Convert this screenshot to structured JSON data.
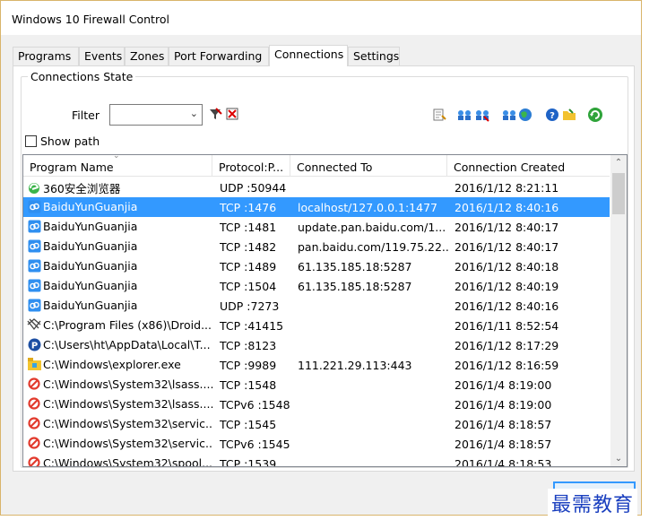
{
  "window": {
    "title": "Windows 10 Firewall Control"
  },
  "tabs": [
    {
      "label": "Programs",
      "active": false
    },
    {
      "label": "Events",
      "active": false
    },
    {
      "label": "Zones",
      "active": false
    },
    {
      "label": "Port Forwarding",
      "active": false
    },
    {
      "label": "Connections",
      "active": true
    },
    {
      "label": "Settings",
      "active": false
    }
  ],
  "group": {
    "title": "Connections State"
  },
  "filter": {
    "label": "Filter",
    "value": ""
  },
  "show_path": {
    "label": "Show path",
    "checked": false
  },
  "table": {
    "columns": [
      "Program Name",
      "Protocol:P...",
      "Connected To",
      "Connection Created"
    ],
    "rows": [
      {
        "icon": "360-browser-icon",
        "name": "360安全浏览器",
        "protocol": "UDP :50944",
        "connected": "",
        "created": "2016/1/12 8:21:11",
        "selected": false
      },
      {
        "icon": "baidu-cloud-icon",
        "name": "BaiduYunGuanjia",
        "protocol": "TCP :1476",
        "connected": "localhost/127.0.0.1:1477",
        "created": "2016/1/12 8:40:16",
        "selected": true
      },
      {
        "icon": "baidu-cloud-icon",
        "name": "BaiduYunGuanjia",
        "protocol": "TCP :1481",
        "connected": "update.pan.baidu.com/1...",
        "created": "2016/1/12 8:40:17",
        "selected": false
      },
      {
        "icon": "baidu-cloud-icon",
        "name": "BaiduYunGuanjia",
        "protocol": "TCP :1482",
        "connected": "pan.baidu.com/119.75.22...",
        "created": "2016/1/12 8:40:17",
        "selected": false
      },
      {
        "icon": "baidu-cloud-icon",
        "name": "BaiduYunGuanjia",
        "protocol": "TCP :1489",
        "connected": "61.135.185.18:5287",
        "created": "2016/1/12 8:40:18",
        "selected": false
      },
      {
        "icon": "baidu-cloud-icon",
        "name": "BaiduYunGuanjia",
        "protocol": "TCP :1504",
        "connected": "61.135.185.18:5287",
        "created": "2016/1/12 8:40:19",
        "selected": false
      },
      {
        "icon": "baidu-cloud-icon",
        "name": "BaiduYunGuanjia",
        "protocol": "UDP :7273",
        "connected": "",
        "created": "2016/1/12 8:40:16",
        "selected": false
      },
      {
        "icon": "droid-icon",
        "name": "C:\\Program Files (x86)\\Droid...",
        "protocol": "TCP :41415",
        "connected": "",
        "created": "2016/1/11 8:52:54",
        "selected": false
      },
      {
        "icon": "p-app-icon",
        "name": "C:\\Users\\ht\\AppData\\Local\\T...",
        "protocol": "TCP :8123",
        "connected": "",
        "created": "2016/1/12 8:17:29",
        "selected": false
      },
      {
        "icon": "explorer-icon",
        "name": "C:\\Windows\\explorer.exe",
        "protocol": "TCP :9989",
        "connected": "111.221.29.113:443",
        "created": "2016/1/12 8:16:59",
        "selected": false
      },
      {
        "icon": "blocked-icon",
        "name": "C:\\Windows\\System32\\lsass....",
        "protocol": "TCP :1548",
        "connected": "",
        "created": "2016/1/4 8:19:00",
        "selected": false
      },
      {
        "icon": "blocked-icon",
        "name": "C:\\Windows\\System32\\lsass....",
        "protocol": "TCPv6 :1548",
        "connected": "",
        "created": "2016/1/4 8:19:00",
        "selected": false
      },
      {
        "icon": "blocked-icon",
        "name": "C:\\Windows\\System32\\servic...",
        "protocol": "TCP :1545",
        "connected": "",
        "created": "2016/1/4 8:18:57",
        "selected": false
      },
      {
        "icon": "blocked-icon",
        "name": "C:\\Windows\\System32\\servic...",
        "protocol": "TCPv6 :1545",
        "connected": "",
        "created": "2016/1/4 8:18:57",
        "selected": false
      },
      {
        "icon": "blocked-icon",
        "name": "C:\\Windows\\System32\\spool...",
        "protocol": "TCP :1539",
        "connected": "",
        "created": "2016/1/4 8:18:53",
        "selected": false
      }
    ]
  },
  "watermark": {
    "text": "最需教育"
  },
  "colors": {
    "selection": "#3399ff",
    "watermark": "#1a3fbf"
  }
}
